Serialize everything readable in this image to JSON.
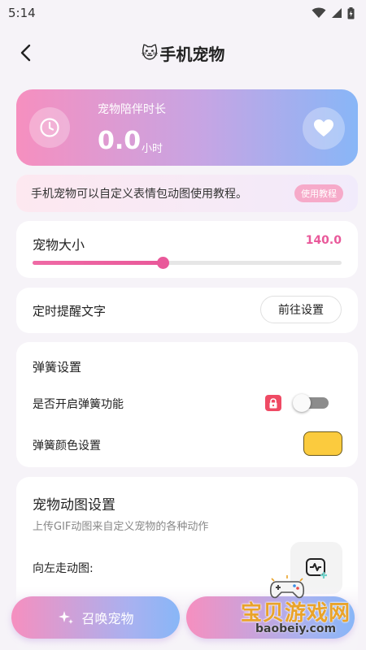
{
  "status_bar": {
    "time": "5:14"
  },
  "header": {
    "title": "手机宠物",
    "title_emoji": "🐱"
  },
  "companion": {
    "label": "宠物陪伴时长",
    "value": "0.0",
    "unit": "小时"
  },
  "tip": {
    "text": "手机宠物可以自定义表情包动图使用教程。",
    "button_label": "使用教程"
  },
  "pet_size": {
    "label": "宠物大小",
    "value": "140.0",
    "slider_fraction": 0.42
  },
  "reminder": {
    "label": "定时提醒文字",
    "button_label": "前往设置"
  },
  "spring": {
    "title": "弹簧设置",
    "enable_label": "是否开启弹簧功能",
    "enabled": false,
    "color_label": "弹簧颜色设置",
    "color": "#fbcb3e"
  },
  "animation": {
    "title": "宠物动图设置",
    "subtitle": "上传GIF动图来自定义宠物的各种动作",
    "walk_left_label": "向左走动图:"
  },
  "bottom": {
    "summon_label": "召唤宠物",
    "second_label": ""
  },
  "watermark": {
    "cn": "宝贝游戏网",
    "en": "baobeiy.com"
  },
  "colors": {
    "accent_pink": "#e9599a",
    "gradient_start": "#f68fbf",
    "gradient_end": "#88b6f7"
  }
}
